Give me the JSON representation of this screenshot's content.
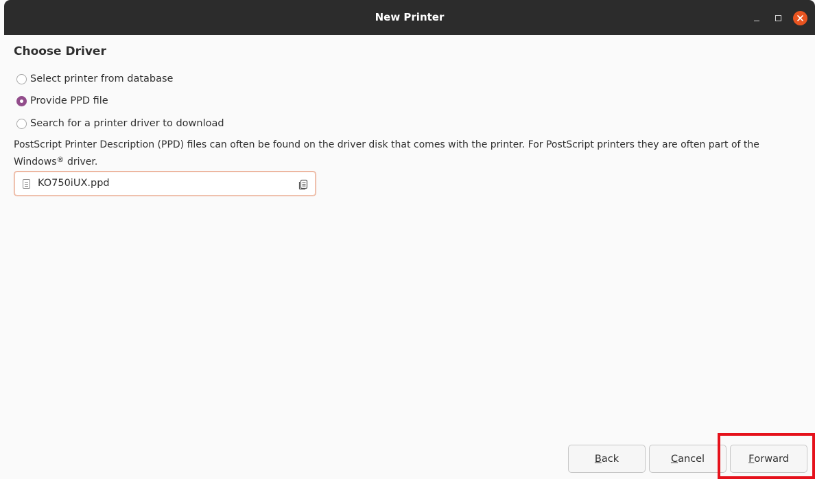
{
  "window": {
    "title": "New Printer",
    "close_color": "#e95420"
  },
  "page": {
    "heading": "Choose Driver",
    "options": [
      {
        "label": "Select printer from database",
        "checked": false
      },
      {
        "label": "Provide PPD file",
        "checked": true
      },
      {
        "label": "Search for a printer driver to download",
        "checked": false
      }
    ],
    "description_main": "PostScript Printer Description (PPD) files can often be found on the driver disk that comes with the printer. For PostScript printers they are often part of the Windows",
    "description_sup": "®",
    "description_end": " driver."
  },
  "file_chooser": {
    "filename": "KO750iUX.ppd",
    "icon": "document-icon",
    "open_icon": "open-file-icon"
  },
  "buttons": {
    "back_mnemonic": "B",
    "back_rest": "ack",
    "cancel_mnemonic": "C",
    "cancel_rest": "ancel",
    "forward_mnemonic": "F",
    "forward_rest": "orward"
  },
  "accent_color": "#924d8b",
  "highlight_color": "#e5111b"
}
